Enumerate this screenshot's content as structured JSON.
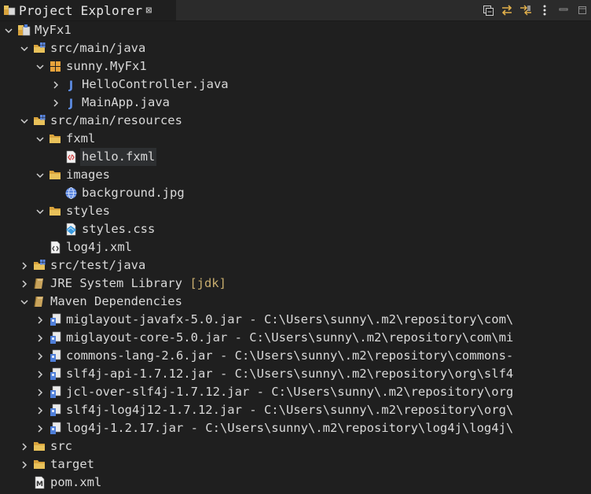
{
  "view": {
    "tab_title": "Project Explorer",
    "close_glyph": "⊠",
    "icons": [
      "collapse-all-icon",
      "link-with-editor-icon",
      "filter-icon",
      "view-menu-icon",
      "minimize-icon",
      "maximize-icon"
    ]
  },
  "tree": [
    {
      "label": "MyFx1",
      "depth": 0,
      "expanded": true,
      "icon": "project"
    },
    {
      "label": "src/main/java",
      "depth": 1,
      "expanded": true,
      "icon": "srcfolder"
    },
    {
      "label": "sunny.MyFx1",
      "depth": 2,
      "expanded": true,
      "icon": "package"
    },
    {
      "label": "HelloController.java",
      "depth": 3,
      "expanded": false,
      "icon": "java"
    },
    {
      "label": "MainApp.java",
      "depth": 3,
      "expanded": false,
      "icon": "java"
    },
    {
      "label": "src/main/resources",
      "depth": 1,
      "expanded": true,
      "icon": "srcfolder"
    },
    {
      "label": "fxml",
      "depth": 2,
      "expanded": true,
      "icon": "folder"
    },
    {
      "label": "hello.fxml",
      "depth": 3,
      "leaf": true,
      "icon": "fxml",
      "selected": true
    },
    {
      "label": "images",
      "depth": 2,
      "expanded": true,
      "icon": "folder"
    },
    {
      "label": "background.jpg",
      "depth": 3,
      "leaf": true,
      "icon": "image"
    },
    {
      "label": "styles",
      "depth": 2,
      "expanded": true,
      "icon": "folder"
    },
    {
      "label": "styles.css",
      "depth": 3,
      "leaf": true,
      "icon": "css"
    },
    {
      "label": "log4j.xml",
      "depth": 2,
      "leaf": true,
      "icon": "xml"
    },
    {
      "label": "src/test/java",
      "depth": 1,
      "expanded": false,
      "icon": "srcfolder"
    },
    {
      "label": "JRE System Library",
      "decoration": "[jdk]",
      "depth": 1,
      "expanded": false,
      "icon": "library"
    },
    {
      "label": "Maven Dependencies",
      "depth": 1,
      "expanded": true,
      "icon": "library"
    },
    {
      "label": "miglayout-javafx-5.0.jar",
      "description": " - C:\\Users\\sunny\\.m2\\repository\\com\\",
      "depth": 2,
      "expanded": false,
      "icon": "jar"
    },
    {
      "label": "miglayout-core-5.0.jar",
      "description": " - C:\\Users\\sunny\\.m2\\repository\\com\\mi",
      "depth": 2,
      "expanded": false,
      "icon": "jar"
    },
    {
      "label": "commons-lang-2.6.jar",
      "description": " - C:\\Users\\sunny\\.m2\\repository\\commons-",
      "depth": 2,
      "expanded": false,
      "icon": "jar"
    },
    {
      "label": "slf4j-api-1.7.12.jar",
      "description": " - C:\\Users\\sunny\\.m2\\repository\\org\\slf4",
      "depth": 2,
      "expanded": false,
      "icon": "jar"
    },
    {
      "label": "jcl-over-slf4j-1.7.12.jar",
      "description": " - C:\\Users\\sunny\\.m2\\repository\\org",
      "depth": 2,
      "expanded": false,
      "icon": "jar"
    },
    {
      "label": "slf4j-log4j12-1.7.12.jar",
      "description": " - C:\\Users\\sunny\\.m2\\repository\\org\\",
      "depth": 2,
      "expanded": false,
      "icon": "jar"
    },
    {
      "label": "log4j-1.2.17.jar",
      "description": " - C:\\Users\\sunny\\.m2\\repository\\log4j\\log4j\\",
      "depth": 2,
      "expanded": false,
      "icon": "jar"
    },
    {
      "label": "src",
      "depth": 1,
      "expanded": false,
      "icon": "folder"
    },
    {
      "label": "target",
      "depth": 1,
      "expanded": false,
      "icon": "folder"
    },
    {
      "label": "pom.xml",
      "depth": 1,
      "leaf": true,
      "icon": "pom"
    }
  ]
}
